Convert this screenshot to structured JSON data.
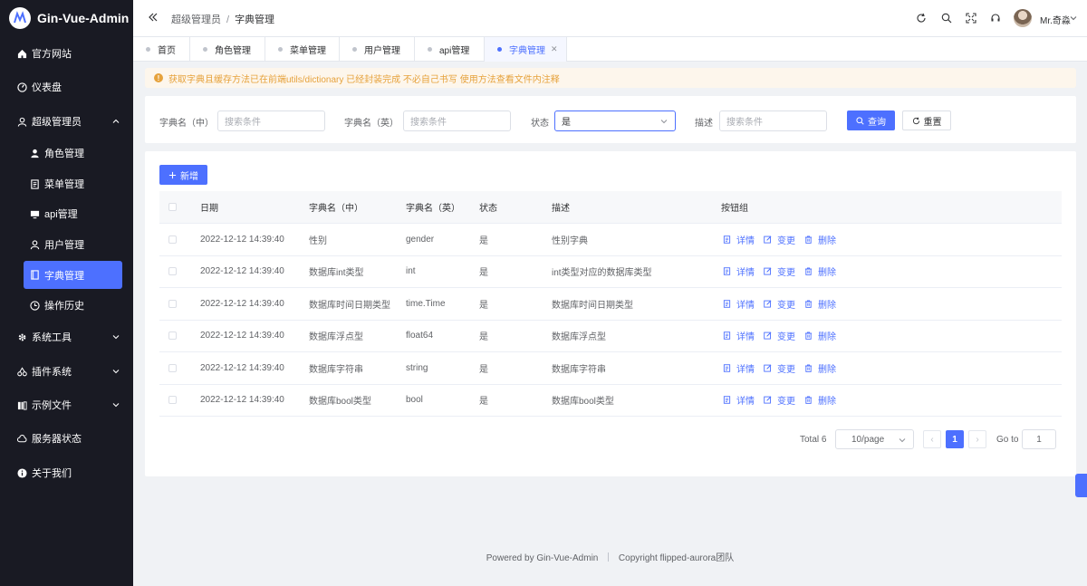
{
  "app": {
    "title": "Gin-Vue-Admin"
  },
  "sidebar": {
    "items": [
      {
        "label": "官方网站",
        "icon": "home-icon"
      },
      {
        "label": "仪表盘",
        "icon": "dashboard-icon"
      },
      {
        "label": "超级管理员",
        "icon": "user-icon",
        "expanded": true
      },
      {
        "label": "角色管理",
        "icon": "avatar-icon"
      },
      {
        "label": "菜单管理",
        "icon": "document-icon"
      },
      {
        "label": "api管理",
        "icon": "monitor-icon"
      },
      {
        "label": "用户管理",
        "icon": "user-filled-icon"
      },
      {
        "label": "字典管理",
        "icon": "notebook-icon",
        "active": true
      },
      {
        "label": "操作历史",
        "icon": "clock-icon"
      },
      {
        "label": "系统工具",
        "icon": "tools-icon"
      },
      {
        "label": "插件系统",
        "icon": "cherry-icon"
      },
      {
        "label": "示例文件",
        "icon": "files-icon"
      },
      {
        "label": "服务器状态",
        "icon": "cloud-icon"
      },
      {
        "label": "关于我们",
        "icon": "info-icon"
      }
    ]
  },
  "header": {
    "breadcrumb": [
      "超级管理员",
      "字典管理"
    ],
    "separator": "/",
    "user_name": "Mr.奇淼"
  },
  "tabs": [
    {
      "label": "首页"
    },
    {
      "label": "角色管理"
    },
    {
      "label": "菜单管理"
    },
    {
      "label": "用户管理"
    },
    {
      "label": "api管理"
    },
    {
      "label": "字典管理",
      "active": true
    }
  ],
  "alert": {
    "text": "获取字典且缓存方法已在前端utils/dictionary 已经封装完成 不必自己书写 使用方法查看文件内注释"
  },
  "search": {
    "name_cn_label": "字典名（中）",
    "name_cn_placeholder": "搜索条件",
    "name_en_label": "字典名（英）",
    "name_en_placeholder": "搜索条件",
    "status_label": "状态",
    "status_value": "是",
    "desc_label": "描述",
    "desc_placeholder": "搜索条件",
    "query_label": "查询",
    "reset_label": "重置"
  },
  "table": {
    "add_label": "新增",
    "columns": [
      "日期",
      "字典名（中）",
      "字典名（英）",
      "状态",
      "描述",
      "按钮组"
    ],
    "rows": [
      {
        "date": "2022-12-12 14:39:40",
        "name_cn": "性别",
        "name_en": "gender",
        "status": "是",
        "desc": "性别字典"
      },
      {
        "date": "2022-12-12 14:39:40",
        "name_cn": "数据库int类型",
        "name_en": "int",
        "status": "是",
        "desc": "int类型对应的数据库类型"
      },
      {
        "date": "2022-12-12 14:39:40",
        "name_cn": "数据库时间日期类型",
        "name_en": "time.Time",
        "status": "是",
        "desc": "数据库时间日期类型"
      },
      {
        "date": "2022-12-12 14:39:40",
        "name_cn": "数据库浮点型",
        "name_en": "float64",
        "status": "是",
        "desc": "数据库浮点型"
      },
      {
        "date": "2022-12-12 14:39:40",
        "name_cn": "数据库字符串",
        "name_en": "string",
        "status": "是",
        "desc": "数据库字符串"
      },
      {
        "date": "2022-12-12 14:39:40",
        "name_cn": "数据库bool类型",
        "name_en": "bool",
        "status": "是",
        "desc": "数据库bool类型"
      }
    ],
    "actions": {
      "detail": "详情",
      "edit": "变更",
      "delete": "删除"
    }
  },
  "pagination": {
    "total_text": "Total 6",
    "page_size": "10/page",
    "current_page": "1",
    "prev": "‹",
    "next": "›",
    "goto_label": "Go to",
    "goto_value": "1"
  },
  "footer": {
    "powered": "Powered by",
    "powered_name": "Gin-Vue-Admin",
    "copyright": "Copyright",
    "copyright_name": "flipped-aurora团队"
  },
  "colors": {
    "primary": "#4d70ff",
    "sidebar_bg": "#191a23",
    "warning": "#e6a23c"
  }
}
